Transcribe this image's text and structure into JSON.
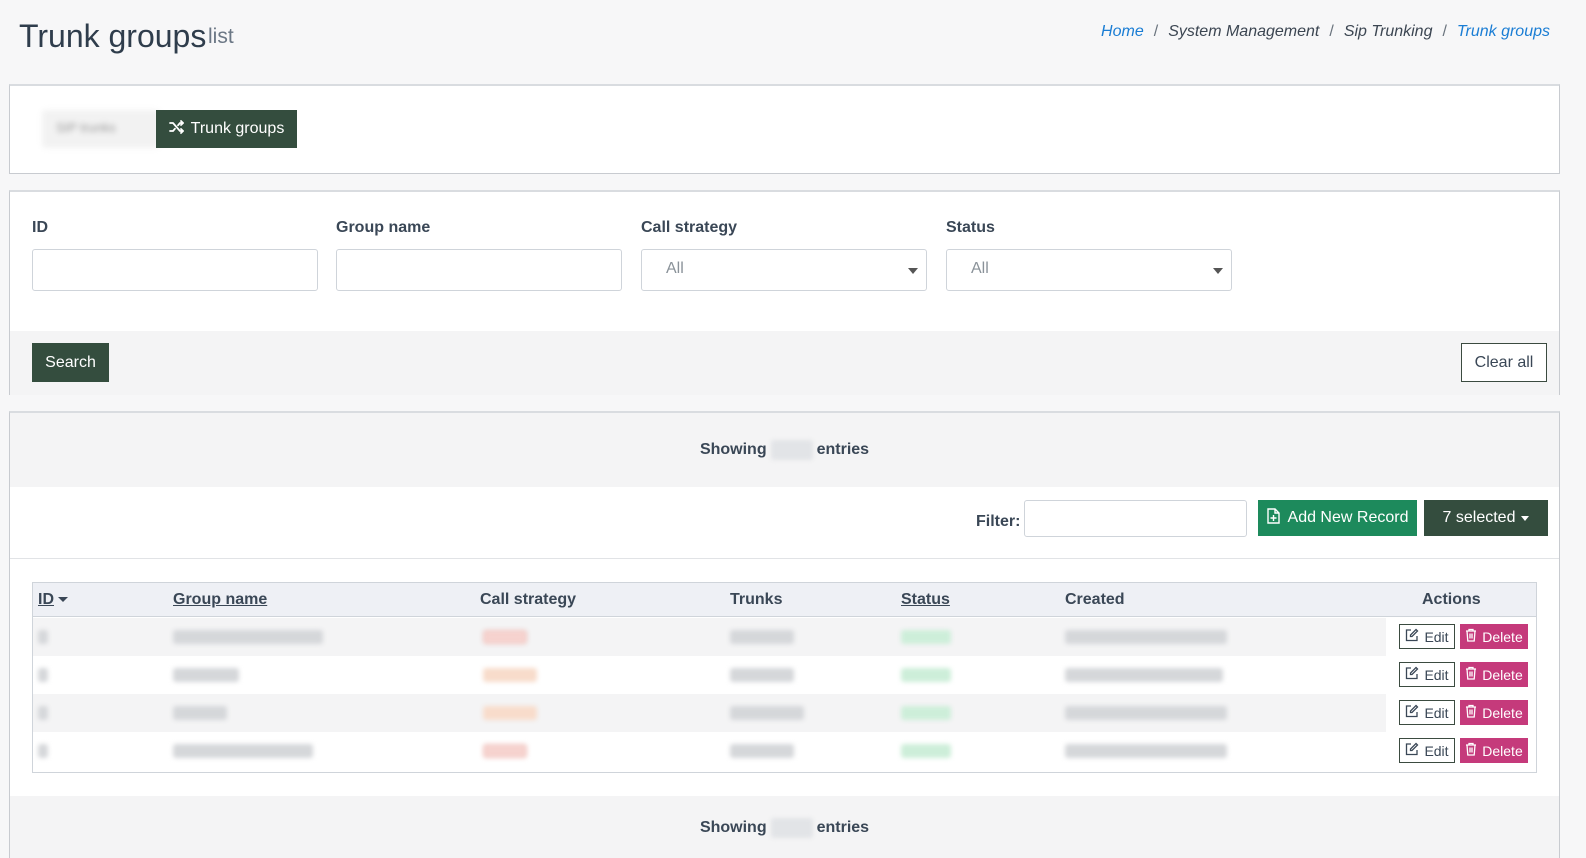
{
  "header": {
    "title": "Trunk groups",
    "subtitle": "list",
    "breadcrumb": [
      {
        "label": "Home",
        "link": true
      },
      {
        "label": "System Management",
        "link": false
      },
      {
        "label": "Sip Trunking",
        "link": false
      },
      {
        "label": "Trunk groups",
        "link": true
      }
    ],
    "breadcrumb_separator": "/"
  },
  "tabs": {
    "inactive_label": "SIP trunks",
    "active_label": "Trunk groups",
    "active_icon": "shuffle-icon"
  },
  "search": {
    "fields": [
      {
        "label": "ID",
        "type": "input",
        "value": ""
      },
      {
        "label": "Group name",
        "type": "input",
        "value": ""
      },
      {
        "label": "Call strategy",
        "type": "select",
        "value": "All"
      },
      {
        "label": "Status",
        "type": "select",
        "value": "All"
      }
    ],
    "search_button": "Search",
    "clear_button": "Clear all"
  },
  "table": {
    "showing_prefix": "Showing",
    "showing_suffix": "entries",
    "filter_label": "Filter:",
    "filter_value": "",
    "add_button": "Add New Record",
    "selected_button": "7 selected",
    "columns": [
      "ID",
      "Group name ",
      "Call strategy",
      "Trunks",
      "Status ",
      "Created",
      "Actions"
    ],
    "edit_label": "Edit",
    "delete_label": "Delete"
  },
  "colors": {
    "primary_dark_green": "#344d3e",
    "add_green": "#1d8a5c",
    "delete_pink": "#c53a7b",
    "link_blue": "#1a7dd4"
  }
}
